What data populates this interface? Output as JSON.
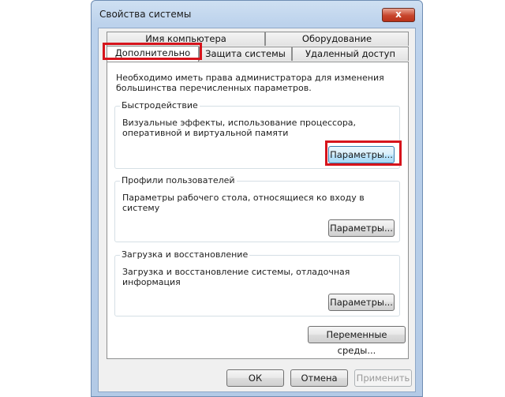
{
  "window": {
    "title": "Свойства системы",
    "close_glyph": "x"
  },
  "tabs": {
    "computer_name": "Имя компьютера",
    "hardware": "Оборудование",
    "advanced": "Дополнительно",
    "system_protection": "Защита системы",
    "remote": "Удаленный доступ"
  },
  "panel": {
    "intro": "Необходимо иметь права администратора для изменения большинства перечисленных параметров.",
    "performance": {
      "label": "Быстродействие",
      "description": "Визуальные эффекты, использование процессора, оперативной и виртуальной памяти",
      "button": "Параметры..."
    },
    "user_profiles": {
      "label": "Профили пользователей",
      "description": "Параметры рабочего стола, относящиеся ко входу в систему",
      "button": "Параметры..."
    },
    "startup_recovery": {
      "label": "Загрузка и восстановление",
      "description": "Загрузка и восстановление системы, отладочная информация",
      "button": "Параметры..."
    },
    "env_button": "Переменные среды..."
  },
  "footer": {
    "ok": "ОК",
    "cancel": "Отмена",
    "apply": "Применить"
  },
  "colors": {
    "highlight": "#d6141c",
    "accent_border": "#3c7fb1"
  }
}
